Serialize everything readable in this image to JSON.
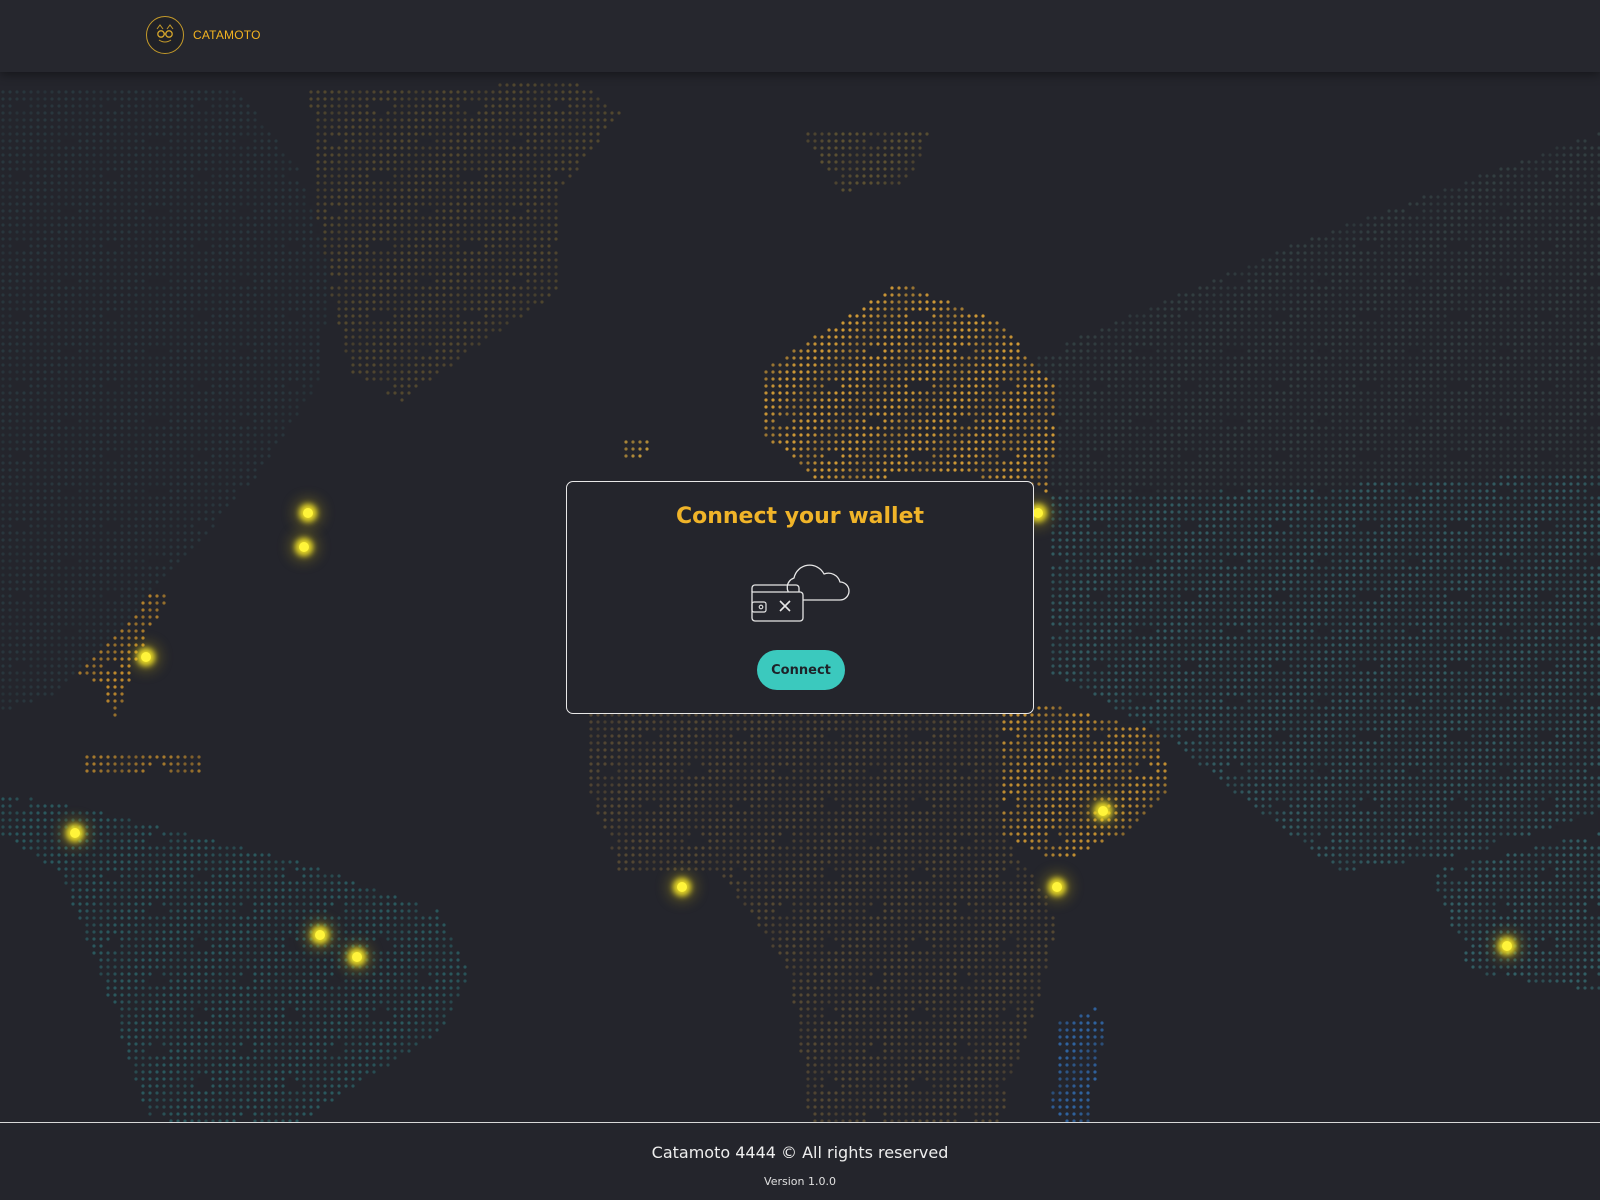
{
  "header": {
    "brand_name": "CATAMOTO",
    "logo_icon": "cat-with-glasses-logo"
  },
  "modal": {
    "title": "Connect your wallet",
    "illustration_icon": "wallet-cloud-disconnected-icon",
    "connect_label": "Connect"
  },
  "map": {
    "style": "dotted world map",
    "hotspot_count": 13
  },
  "footer": {
    "copyright": "Catamoto 4444 © All rights reserved",
    "version": "Version 1.0.0"
  },
  "colors": {
    "background": "#24252c",
    "accent_gold": "#f0b429",
    "button_teal": "#3bc9be",
    "hotspot_yellow": "#fff43a"
  }
}
